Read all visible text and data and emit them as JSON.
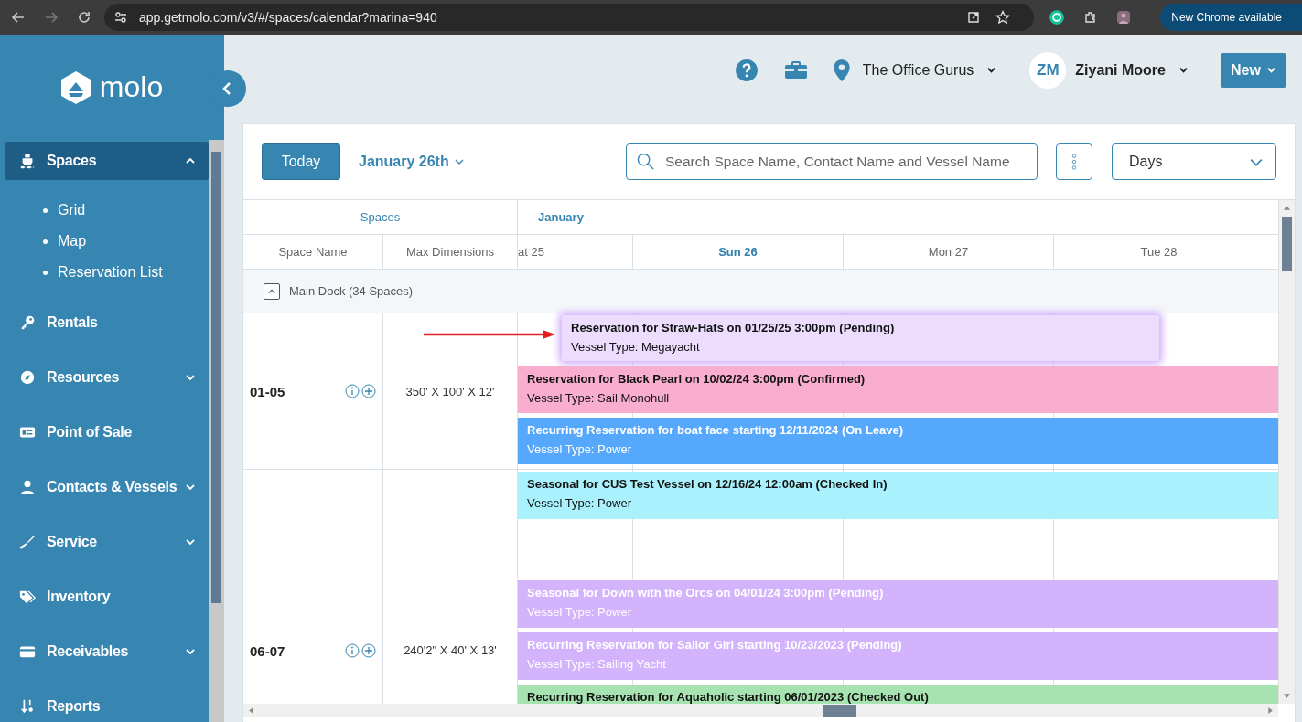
{
  "browser": {
    "url": "app.getmolo.com/v3/#/spaces/calendar?marina=940",
    "update_badge": "New Chrome available"
  },
  "sidebar": {
    "logo": "molo",
    "items": [
      {
        "label": "Spaces",
        "selected": true,
        "expanded": true,
        "children": [
          {
            "label": "Grid"
          },
          {
            "label": "Map"
          },
          {
            "label": "Reservation List"
          }
        ]
      },
      {
        "label": "Rentals",
        "selected": false
      },
      {
        "label": "Resources",
        "selected": false,
        "expanded": false
      },
      {
        "label": "Point of Sale",
        "selected": false
      },
      {
        "label": "Contacts & Vessels",
        "selected": false,
        "expanded": false
      },
      {
        "label": "Service",
        "selected": false,
        "expanded": false
      },
      {
        "label": "Inventory",
        "selected": false
      },
      {
        "label": "Receivables",
        "selected": false,
        "expanded": false
      },
      {
        "label": "Reports",
        "selected": false
      }
    ]
  },
  "header": {
    "location": "The Office Gurus",
    "user": {
      "initials": "ZM",
      "name": "Ziyani Moore"
    },
    "new_button": "New"
  },
  "toolbar": {
    "today": "Today",
    "date": "January 26th",
    "search": {
      "placeholder": "Search Space Name, Contact Name and Vessel Name"
    },
    "view": "Days"
  },
  "calendar": {
    "spaces_header": "Spaces",
    "month": "January",
    "columns": [
      "Space Name",
      "Max Dimensions"
    ],
    "days": [
      {
        "label": "at 25",
        "selected": false
      },
      {
        "label": "Sun 26",
        "selected": true
      },
      {
        "label": "Mon 27",
        "selected": false
      },
      {
        "label": "Tue 28",
        "selected": false
      }
    ],
    "group": {
      "label": "Main Dock (34 Spaces)",
      "expanded": true
    },
    "spaces": [
      {
        "name": "01-05",
        "dimensions": "350' X 100' X 12'",
        "reservations": [
          {
            "kind": "dragged",
            "title": "Reservation for Straw-Hats on 01/25/25 3:00pm (Pending)",
            "vessel_label": "Vessel Type:",
            "vessel_type": "Megayacht",
            "color": "#ecdcfd",
            "light_text": false,
            "gap_before": false
          },
          {
            "kind": "booking",
            "title": "Reservation for Black Pearl on 10/02/24 3:00pm (Confirmed)",
            "vessel_label": "Vessel Type:",
            "vessel_type": "Sail Monohull",
            "color": "#f9aed0",
            "light_text": false,
            "gap_before": false
          },
          {
            "kind": "booking",
            "title": "Recurring Reservation for boat face starting 12/11/2024 (On Leave)",
            "vessel_label": "Vessel Type:",
            "vessel_type": "Power",
            "color": "#56a8fd",
            "light_text": true,
            "gap_before": false
          }
        ]
      },
      {
        "name": "06-07",
        "dimensions": "240'2\" X 40' X 13'",
        "reservations": [
          {
            "kind": "booking",
            "title": "Seasonal for CUS Test Vessel on 12/16/24 12:00am (Checked In)",
            "vessel_label": "Vessel Type:",
            "vessel_type": "Power",
            "color": "#a9f2fd",
            "light_text": false,
            "gap_before": false
          },
          {
            "kind": "booking",
            "title": "Seasonal for Down with the Orcs on 04/01/24 3:00pm (Pending)",
            "vessel_label": "Vessel Type:",
            "vessel_type": "Power",
            "color": "#d2b3fc",
            "light_text": true,
            "gap_before": true
          },
          {
            "kind": "booking",
            "title": "Recurring Reservation for Sailor Girl starting 10/23/2023 (Pending)",
            "vessel_label": "Vessel Type:",
            "vessel_type": "Sailing Yacht",
            "color": "#d2b3fc",
            "light_text": true,
            "gap_before": false
          },
          {
            "kind": "booking",
            "title": "Recurring Reservation for Aquaholic starting 06/01/2023 (Checked Out)",
            "color": "#a6e3b0",
            "light_text": false,
            "gap_before": false
          }
        ]
      }
    ]
  }
}
